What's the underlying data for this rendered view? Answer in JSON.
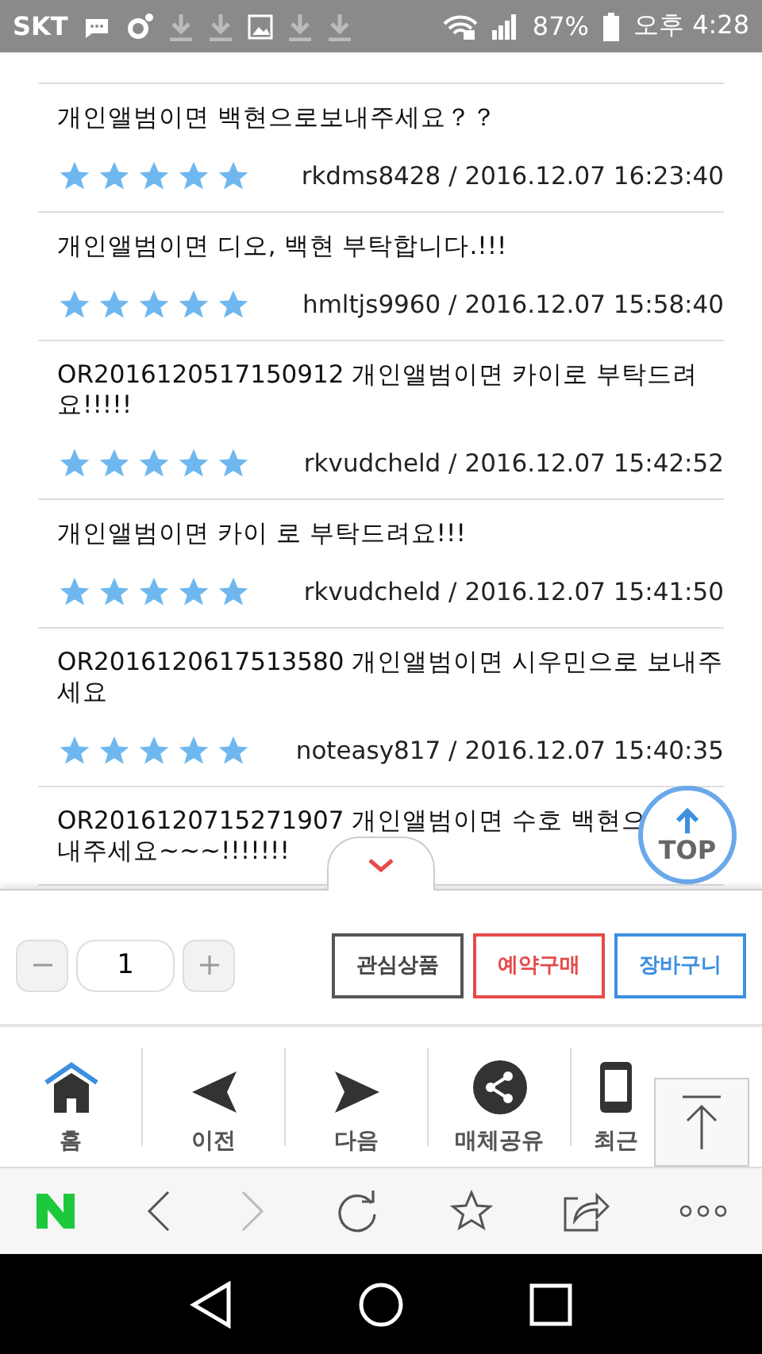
{
  "status_bar": {
    "carrier": "SKT",
    "battery": "87%",
    "time": "오후 4:28"
  },
  "reviews": [
    {
      "text": "개인앨범이면 백현으로보내주세요？？",
      "stars": 5,
      "meta": "rkdms8428 / 2016.12.07 16:23:40"
    },
    {
      "text": "개인앨범이면 디오, 백현 부탁합니다.!!!",
      "stars": 5,
      "meta": "hmltjs9960 / 2016.12.07 15:58:40"
    },
    {
      "text": "OR2016120517150912 개인앨범이면 카이로 부탁드려요!!!!!",
      "stars": 5,
      "meta": "rkvudcheld / 2016.12.07 15:42:52"
    },
    {
      "text": "개인앨범이면 카이 로 부탁드려요!!!",
      "stars": 5,
      "meta": "rkvudcheld / 2016.12.07 15:41:50"
    },
    {
      "text": "OR2016120617513580 개인앨범이면 시우민으로 보내주세요",
      "stars": 5,
      "meta": "noteasy817 / 2016.12.07 15:40:35"
    },
    {
      "text": "OR2016120715271907 개인앨범이면 수호 백현으",
      "continuation": "내주세요~~~!!!!!!!"
    }
  ],
  "top_button": "TOP",
  "quantity": "1",
  "actions": [
    {
      "label": "관심상품",
      "kind": "wish"
    },
    {
      "label": "예약구매",
      "kind": "reserve"
    },
    {
      "label": "장바구니",
      "kind": "cart"
    }
  ],
  "nav": [
    {
      "label": "홈",
      "kind": "home"
    },
    {
      "label": "이전",
      "kind": "prev"
    },
    {
      "label": "다음",
      "kind": "next"
    },
    {
      "label": "매체공유",
      "kind": "share"
    },
    {
      "label": "최근",
      "kind": "recent"
    }
  ],
  "browser_bar": {
    "forward_disabled": true
  }
}
